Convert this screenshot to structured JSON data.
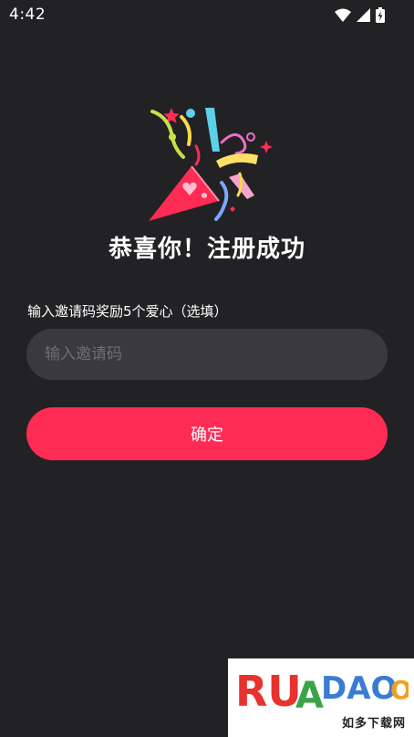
{
  "status_bar": {
    "time": "4:42",
    "icons": [
      "wifi-icon",
      "cellular-signal-icon",
      "battery-charging-icon"
    ]
  },
  "hero": {
    "icon": "party-popper-icon",
    "colors": {
      "cone": "#fe2c55",
      "confetti": [
        "#fe2c55",
        "#ffd84d",
        "#5ed0e8",
        "#f06fc4",
        "#c9e04a",
        "#7ba7ff"
      ]
    }
  },
  "title": "恭喜你！注册成功",
  "invite": {
    "label": "输入邀请码奖励5个爱心（选填）",
    "placeholder": "输入邀请码",
    "value": ""
  },
  "confirm_button": {
    "label": "确定"
  },
  "watermark": {
    "logo_text": "RUANDAOO",
    "subtitle": "如多下载网"
  },
  "colors": {
    "background": "#222124",
    "input_background": "#3a3a3d",
    "accent": "#fe2c55",
    "placeholder": "#6f6f73"
  }
}
